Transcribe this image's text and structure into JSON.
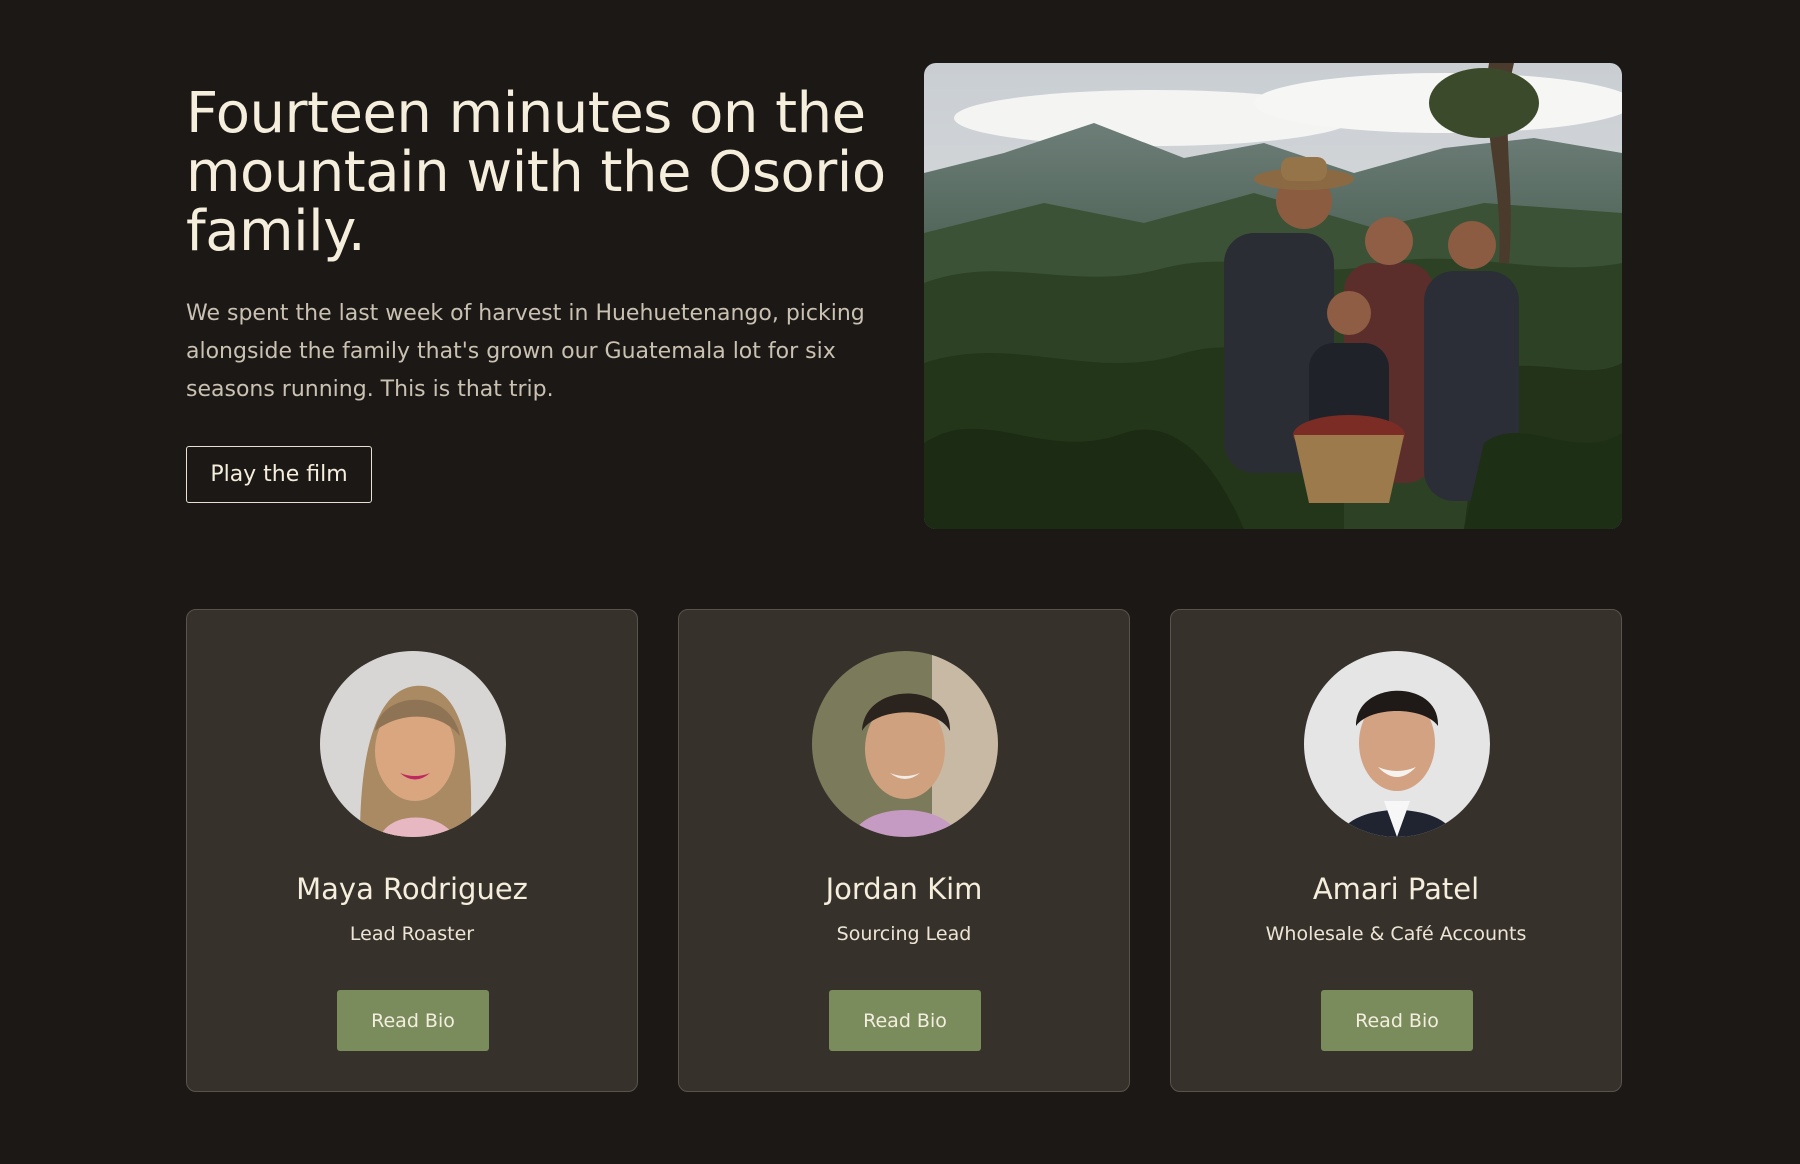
{
  "hero": {
    "title": "Fourteen minutes on the mountain with the Osorio family.",
    "description": "We spent the last week of harvest in Huehuetenango, picking alongside the family that's grown our Guatemala lot for six seasons running. This is that trip.",
    "play_label": "Play the film"
  },
  "team": [
    {
      "name": "Maya Rodriguez",
      "role": "Lead Roaster",
      "button": "Read Bio"
    },
    {
      "name": "Jordan Kim",
      "role": "Sourcing Lead",
      "button": "Read Bio"
    },
    {
      "name": "Amari Patel",
      "role": "Wholesale & Café Accounts",
      "button": "Read Bio"
    }
  ],
  "colors": {
    "background": "#1c1815",
    "card": "#37312c",
    "accent_button": "#7a8c5c"
  }
}
